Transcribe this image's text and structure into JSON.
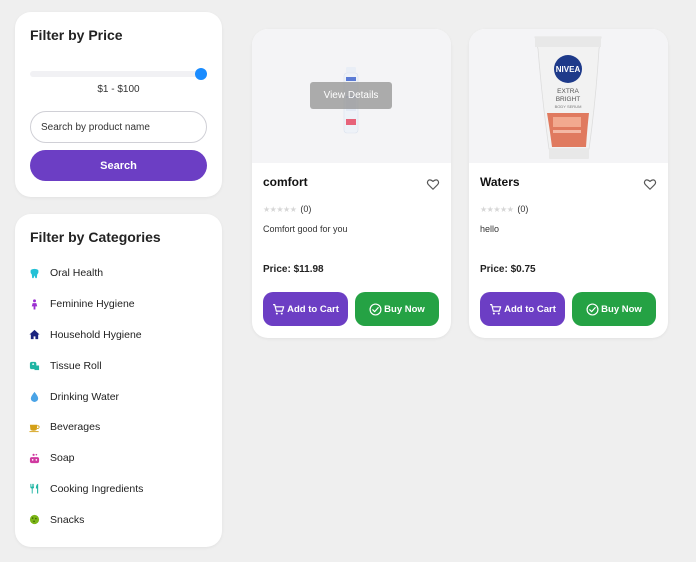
{
  "price_filter": {
    "title": "Filter by Price",
    "range_text": "$1 - $100",
    "slider_fraction": 1.0,
    "search_placeholder": "Search by product name",
    "search_button": "Search"
  },
  "categories": {
    "title": "Filter by Categories",
    "items": [
      {
        "label": "Oral Health",
        "icon": "tooth-icon",
        "color": "#22c1d6"
      },
      {
        "label": "Feminine Hygiene",
        "icon": "female-icon",
        "color": "#9b2fd1"
      },
      {
        "label": "Household Hygiene",
        "icon": "home-icon",
        "color": "#1a237e"
      },
      {
        "label": "Tissue Roll",
        "icon": "toilet-paper-icon",
        "color": "#1fb5a3"
      },
      {
        "label": "Drinking Water",
        "icon": "water-drop-icon",
        "color": "#4aa3e6"
      },
      {
        "label": "Beverages",
        "icon": "coffee-cup-icon",
        "color": "#d4a017"
      },
      {
        "label": "Soap",
        "icon": "soap-icon",
        "color": "#d03aa0"
      },
      {
        "label": "Cooking Ingredients",
        "icon": "utensils-icon",
        "color": "#1fb5a3"
      },
      {
        "label": "Snacks",
        "icon": "cookie-icon",
        "color": "#7cb518"
      }
    ]
  },
  "products": [
    {
      "name": "comfort",
      "stars": "★★★★★",
      "review_count": "(0)",
      "description": "Comfort good for you",
      "price": "Price: $11.98",
      "add_to_cart": "Add to Cart",
      "buy_now": "Buy Now",
      "overlay": "View Details"
    },
    {
      "name": "Waters",
      "stars": "★★★★★",
      "review_count": "(0)",
      "description": "hello",
      "price": "Price: $0.75",
      "add_to_cart": "Add to Cart",
      "buy_now": "Buy Now",
      "image_brand": "NIVEA",
      "image_line1": "EXTRA",
      "image_line2": "BRIGHT",
      "image_line3": "BODY SERUM"
    }
  ],
  "colors": {
    "primary": "#6c3ec4",
    "buy": "#25a244",
    "slider": "#1a8cff"
  }
}
